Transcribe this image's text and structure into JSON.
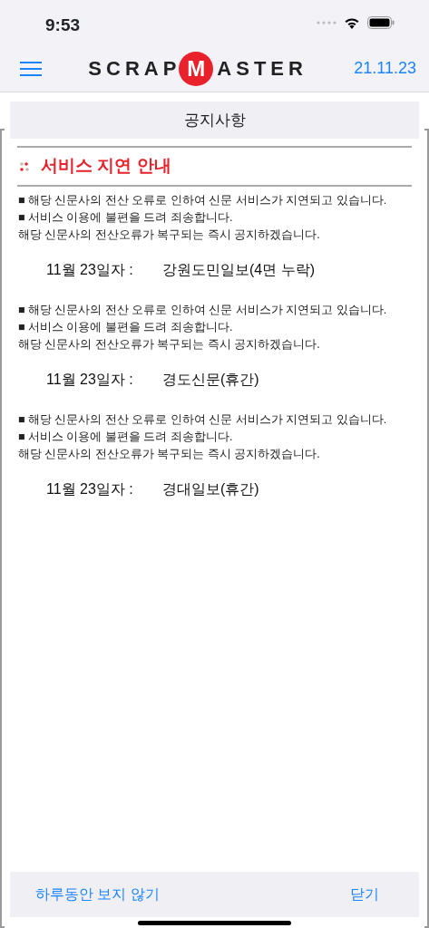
{
  "status_bar": {
    "time": "9:53"
  },
  "nav": {
    "logo": [
      "SCRAP",
      "M",
      "ASTER"
    ],
    "date": "21.11.23"
  },
  "dialog": {
    "title": "공지사항",
    "heading": "서비스 지연 안내",
    "blocks": [
      {
        "kind": "text",
        "lines": [
          "■ 해당 신문사의 전산 오류로 인하여 신문 서비스가 지연되고 있습니다.",
          "■ 서비스 이용에 불편을 드려 죄송합니다.",
          "해당 신문사의 전산오류가 복구되는 즉시 공지하겠습니다."
        ]
      },
      {
        "kind": "entry",
        "date": "11월 23일자 :",
        "paper": "강원도민일보(4면 누락)"
      },
      {
        "kind": "text",
        "lines": [
          "■ 해당 신문사의 전산 오류로 인하여 신문 서비스가 지연되고 있습니다.",
          "■ 서비스 이용에 불편을 드려 죄송합니다.",
          "해당 신문사의 전산오류가 복구되는 즉시 공지하겠습니다."
        ]
      },
      {
        "kind": "entry",
        "date": "11월 23일자 :",
        "paper": "경도신문(휴간)"
      },
      {
        "kind": "text",
        "lines": [
          "■ 해당 신문사의 전산 오류로 인하여 신문 서비스가 지연되고 있습니다.",
          "■ 서비스 이용에 불편을 드려 죄송합니다.",
          "해당 신문사의 전산오류가 복구되는 즉시 공지하겠습니다."
        ]
      },
      {
        "kind": "entry",
        "date": "11월 23일자 :",
        "paper": "경대일보(휴간)"
      }
    ],
    "buttons": [
      "하루동안 보지 않기",
      "닫기"
    ]
  }
}
